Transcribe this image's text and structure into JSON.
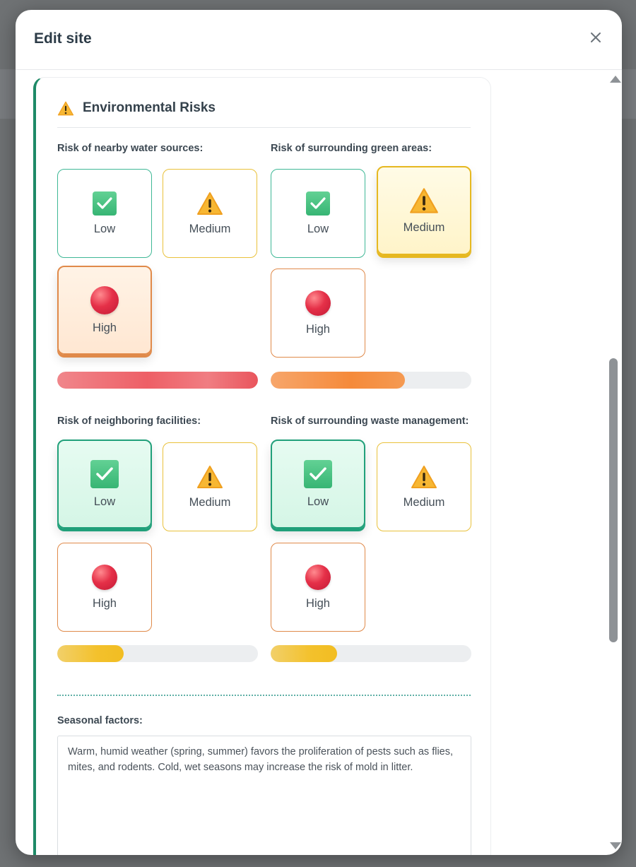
{
  "modal": {
    "title": "Edit site",
    "close_label": "×"
  },
  "section": {
    "title": "Environmental Risks",
    "icon": "warning-icon"
  },
  "options": {
    "low": "Low",
    "medium": "Medium",
    "high": "High"
  },
  "risks": [
    {
      "label": "Risk of nearby water sources:",
      "selected": "high",
      "bar_level": 1.0,
      "bar_color": "#ee5f66"
    },
    {
      "label": "Risk of surrounding green areas:",
      "selected": "medium",
      "bar_level": 0.67,
      "bar_color": "#f58a3a"
    },
    {
      "label": "Risk of neighboring facilities:",
      "selected": "low",
      "bar_level": 0.33,
      "bar_color": "#f3c12c"
    },
    {
      "label": "Risk of surrounding waste management:",
      "selected": "low",
      "bar_level": 0.33,
      "bar_color": "#f3c12c"
    }
  ],
  "seasonal": {
    "label": "Seasonal factors:",
    "value": "Warm, humid weather (spring, summer) favors the proliferation of pests such as flies, mites, and rodents. Cold, wet seasons may increase the risk of mold in litter."
  },
  "colors": {
    "accent": "#1e8a67",
    "low": "#3fb896",
    "medium": "#e9c13b",
    "high": "#e08a4a"
  }
}
